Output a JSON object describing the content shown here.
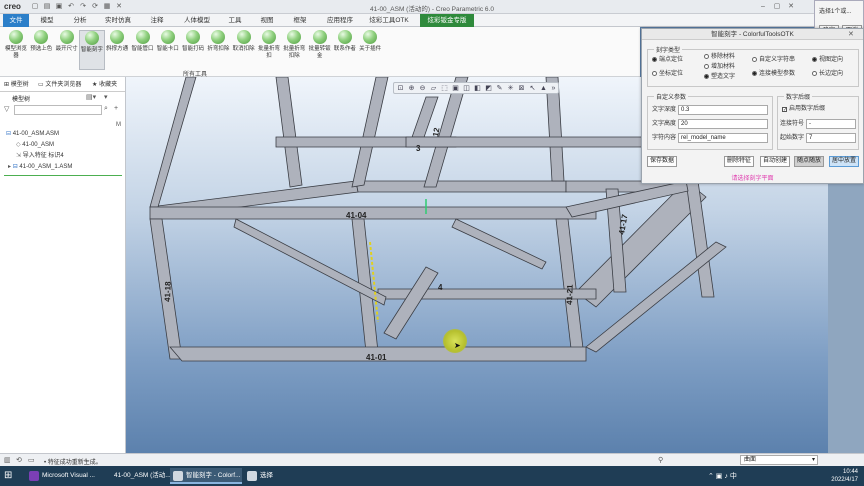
{
  "titlebar": {
    "logo": "creo",
    "title": "41-00_ASM (活动的) - Creo Parametric 6.0"
  },
  "tabs": [
    {
      "label": "文件",
      "state": "active"
    },
    {
      "label": "模型",
      "state": ""
    },
    {
      "label": "分析",
      "state": ""
    },
    {
      "label": "实时仿真",
      "state": ""
    },
    {
      "label": "注释",
      "state": ""
    },
    {
      "label": "人体模型",
      "state": ""
    },
    {
      "label": "工具",
      "state": ""
    },
    {
      "label": "视图",
      "state": ""
    },
    {
      "label": "框架",
      "state": ""
    },
    {
      "label": "应用程序",
      "state": ""
    },
    {
      "label": "炫彩工具OTK",
      "state": ""
    },
    {
      "label": "炫彩钣金专版",
      "state": "green"
    }
  ],
  "ribbon": {
    "group_label": "所有工具",
    "buttons": [
      "模型浏览器",
      "预选上色",
      "最开尺寸",
      "智能刻字",
      "斜撑方通",
      "智能管口",
      "智能卡口",
      "智能打码",
      "折弯扣除",
      "取消扣除",
      "批量折弯扣",
      "批量折弯扣除",
      "批量转钣金",
      "联系作者",
      "关于插件"
    ]
  },
  "left_panel": {
    "tab_model_tree": "模型树",
    "tab_folder": "文件夹浏览器",
    "tab_favorites": "收藏夹",
    "subheader": "模型树",
    "col_header": "M",
    "tree": [
      "41-00_ASM.ASM",
      "41-00_ASM",
      "导入特征 标识4",
      "41-00_ASM_1.ASM"
    ]
  },
  "viewport_labels": [
    "41-04",
    "41-01",
    "41-18",
    "41-21",
    "41-17",
    "12",
    "3",
    "4"
  ],
  "dialog": {
    "title": "智能刻字 - ColorfulToolsOTK",
    "group_type": "刻字类型",
    "type_options": [
      "端点定位",
      "坐标定位",
      "移除材料",
      "增加材料",
      "塑造文字",
      "自定义字符串",
      "连接模型参数",
      "视图定向",
      "长边定向"
    ],
    "group_custom": "自定义参数",
    "depth_label": "文字深度",
    "depth_value": "0.3",
    "height_label": "文字高度",
    "height_value": "20",
    "content_label": "字符内容",
    "content_value": "rel_model_name",
    "group_number": "数字后缀",
    "number_checkbox": "启用数字后缀",
    "sep_label": "连接符号",
    "sep_value": "-",
    "start_label": "起始数字",
    "start_value": "7",
    "btn_save": "保存数据",
    "btn_delete": "删除特征",
    "btn_auto": "自动创建",
    "btn_follow": "随点随放",
    "btn_center": "居中放置",
    "link": "请选择刻字平面"
  },
  "confirm": {
    "hint": "选择1个或...",
    "ok": "确定",
    "cancel": "取消"
  },
  "status": {
    "message": "• 特征成功重新生成。",
    "filter": "曲面"
  },
  "taskbar": {
    "items": [
      "Microsoft Visual ...",
      "41-00_ASM (活动...",
      "智能刻字 - Colorf...",
      "选择"
    ],
    "time": "10:44",
    "date": "2022/4/17"
  }
}
